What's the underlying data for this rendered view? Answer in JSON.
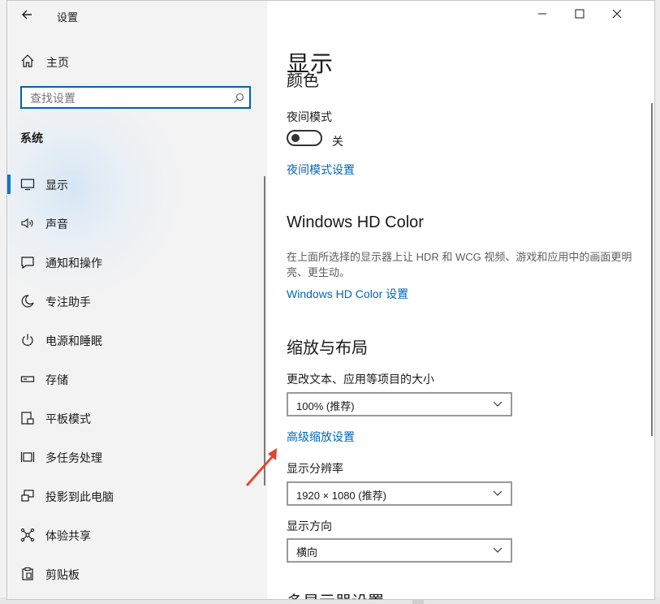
{
  "window": {
    "title": "设置",
    "controls": [
      "minimize-icon",
      "maximize-icon",
      "close-icon"
    ]
  },
  "sidebar": {
    "home_label": "主页",
    "search_placeholder": "查找设置",
    "section_heading": "系统",
    "items": [
      {
        "label": "显示",
        "icon": "monitor-icon",
        "selected": true
      },
      {
        "label": "声音",
        "icon": "speaker-icon",
        "selected": false
      },
      {
        "label": "通知和操作",
        "icon": "notification-icon",
        "selected": false
      },
      {
        "label": "专注助手",
        "icon": "moon-icon",
        "selected": false
      },
      {
        "label": "电源和睡眠",
        "icon": "power-icon",
        "selected": false
      },
      {
        "label": "存储",
        "icon": "storage-icon",
        "selected": false
      },
      {
        "label": "平板模式",
        "icon": "tablet-icon",
        "selected": false
      },
      {
        "label": "多任务处理",
        "icon": "multitask-icon",
        "selected": false
      },
      {
        "label": "投影到此电脑",
        "icon": "project-icon",
        "selected": false
      },
      {
        "label": "体验共享",
        "icon": "share-icon",
        "selected": false
      },
      {
        "label": "剪贴板",
        "icon": "clipboard-icon",
        "selected": false
      }
    ]
  },
  "main": {
    "page_title": "显示",
    "cut_heading": "颜色",
    "night_mode": {
      "label": "夜间模式",
      "state_text": "关",
      "on": false,
      "settings_link": "夜间模式设置"
    },
    "hdr": {
      "heading": "Windows HD Color",
      "description": "在上面所选择的显示器上让 HDR 和 WCG 视频、游戏和应用中的画面更明亮、更生动。",
      "link": "Windows HD Color 设置"
    },
    "scale_layout": {
      "heading": "缩放与布局",
      "text_size_label": "更改文本、应用等项目的大小",
      "text_size_value": "100% (推荐)",
      "advanced_link": "高级缩放设置",
      "resolution_label": "显示分辨率",
      "resolution_value": "1920 × 1080 (推荐)",
      "orientation_label": "显示方向",
      "orientation_value": "横向"
    },
    "bottom_cut_heading": "多显示器设置"
  },
  "colors": {
    "accent": "#0078d7",
    "link": "#0067b8",
    "annotation_arrow": "#e8402a"
  }
}
